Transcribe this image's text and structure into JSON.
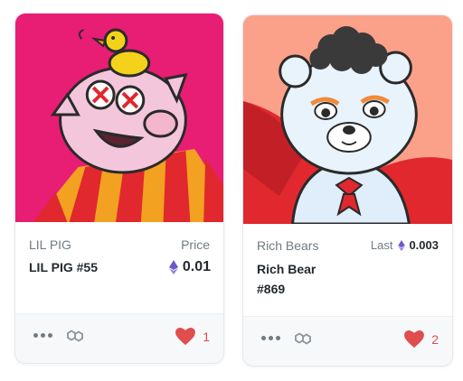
{
  "cards": [
    {
      "collection": "LIL PIG",
      "name": "LIL PIG #55",
      "price_label": "Price",
      "price": "0.01",
      "likes": "1",
      "background": "#e81d74",
      "stripe_a": "#f2a120",
      "stripe_b": "#e0282e"
    },
    {
      "collection": "Rich Bears",
      "name": "Rich Bear #869",
      "price_label": "Last",
      "price": "0.003",
      "likes": "2",
      "background": "#fba089"
    }
  ],
  "colors": {
    "heart": "#e04d4d",
    "eth": "#6e58c8",
    "muted_text": "#707a83",
    "primary_text": "#24292f"
  },
  "icons": {
    "more": "more-dots-icon",
    "chain": "polygon-chain-icon",
    "heart": "heart-icon",
    "currency": "ethereum-icon"
  }
}
